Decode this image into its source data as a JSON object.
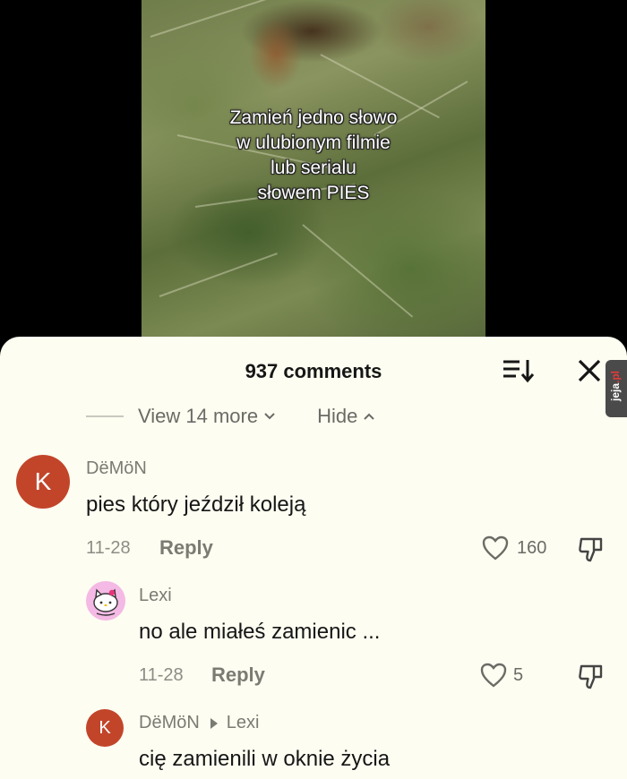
{
  "video": {
    "caption_lines": [
      "Zamień jedno słowo",
      "w ulubionym filmie",
      "lub serialu",
      "słowem PIES"
    ]
  },
  "sheet": {
    "comments_count": "937 comments",
    "sort_icon": "sort-icon",
    "close_icon": "close-icon"
  },
  "watermark": {
    "prefix": "jeja",
    "suffix": ".pl"
  },
  "thread": {
    "view_more": "View 14 more",
    "hide": "Hide"
  },
  "comments": [
    {
      "username": "DëMöN",
      "avatar_letter": "K",
      "text": "pies który jeździł koleją",
      "date": "11-28",
      "reply_label": "Reply",
      "likes": "160"
    },
    {
      "username": "Lexi",
      "text": "no ale miałeś zamienic ...",
      "date": "11-28",
      "reply_label": "Reply",
      "likes": "5"
    },
    {
      "username": "DëMöN",
      "avatar_letter": "K",
      "reply_to": "Lexi",
      "text": "cię zamienili w oknie życia"
    }
  ],
  "colors": {
    "sheet_bg": "#fdfdf1",
    "avatar_k": "#c2452a",
    "avatar_lexi": "#f4b9e4"
  }
}
